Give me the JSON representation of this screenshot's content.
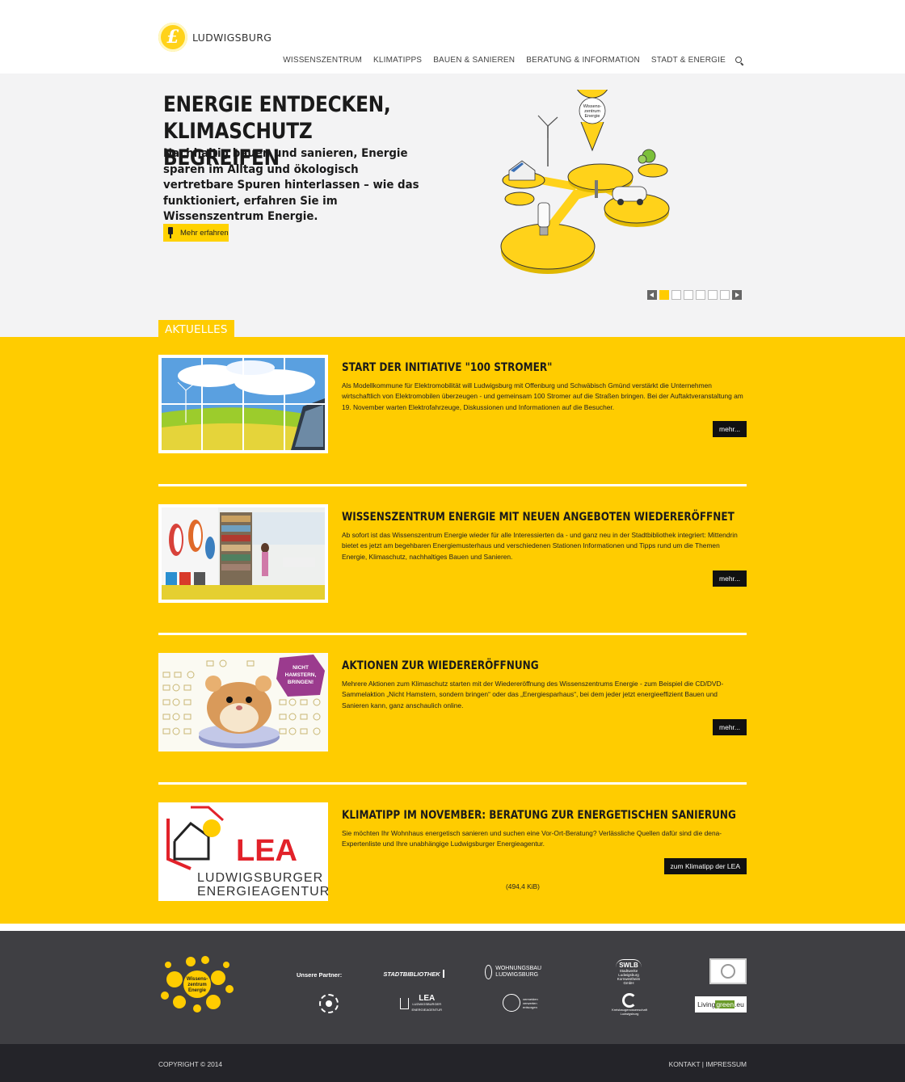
{
  "header": {
    "logo_text": "LUDWIGSBURG",
    "logo_glyph": "£",
    "nav": [
      "WISSENSZENTRUM",
      "KLIMATIPPS",
      "BAUEN & SANIEREN",
      "BERATUNG & INFORMATION",
      "STADT & ENERGIE"
    ]
  },
  "hero": {
    "title_line1": "ENERGIE ENTDECKEN,",
    "title_line2": "KLIMASCHUTZ BEGREIFEN",
    "text": "Nachhaltig bauen und sanieren, Energie sparen im Alltag und ökologisch vertretbare Spuren hinterlassen – wie das funktioniert, erfahren Sie im Wissenszentrum Energie.",
    "button_label": "Mehr erfahren",
    "illustration_pin_text": [
      "Wissens-",
      "zentrum",
      "Energie"
    ],
    "slides_total": 7,
    "slide_active": 1
  },
  "news": {
    "section_label": "AKTUELLES",
    "items": [
      {
        "title": "START DER INITIATIVE \"100 STROMER\"",
        "body": "Als Modellkommune für Elektromobilität will Ludwigsburg mit Offenburg und Schwäbisch Gmünd verstärkt die Unternehmen wirtschaftlich von Elektromobilen überzeugen - und gemeinsam 100 Stromer auf die Straßen bringen. Bei der Auftaktveranstaltung am 19. November warten Elektrofahrzeuge, Diskussionen und Informationen auf die Besucher.",
        "button": "mehr..."
      },
      {
        "title": "WISSENSZENTRUM ENERGIE MIT NEUEN ANGEBOTEN WIEDERERÖFFNET",
        "body": "Ab sofort ist das Wissenszentrum Energie wieder für alle Interessierten da - und ganz neu in der Stadtbibliothek integriert: Mittendrin bietet es jetzt am begehbaren Energiemusterhaus und verschiedenen Stationen Informationen und Tipps rund um die Themen Energie, Klimaschutz, nachhaltiges Bauen und Sanieren.",
        "button": "mehr..."
      },
      {
        "title": "AKTIONEN ZUR WIEDERERÖFFNUNG",
        "body": "Mehrere Aktionen zum Klimaschutz starten mit der Wiedereröffnung des Wissenszentrums Energie - zum Beispiel die CD/DVD-Sammelaktion „Nicht Hamstern, sondern bringen“ oder das „Energiesparhaus“, bei dem jeder jetzt energieeffizient Bauen und Sanieren kann, ganz anschaulich online.",
        "button": "mehr...",
        "badge_text": [
          "NICHT",
          "HAMSTERN,",
          "BRINGEN!"
        ]
      },
      {
        "title": "KLIMATIPP IM NOVEMBER: BERATUNG ZUR ENERGETISCHEN SANIERUNG",
        "body": "Sie möchten Ihr Wohnhaus energetisch sanieren und suchen eine Vor-Ort-Beratung? Verlässliche Quellen dafür sind die dena-Expertenliste und Ihre unabhängige Ludwigsburger Energieagentur.",
        "button": "zum Klimatipp der LEA",
        "file_size": "(494,4 KiB)",
        "logo_main": "LEA",
        "logo_line1": "LUDWIGSBURGER",
        "logo_line2": "ENERGIEAGENTUR"
      }
    ]
  },
  "footer": {
    "logo_text": [
      "Wissens-",
      "zentrum",
      "Energie"
    ],
    "partners_label": "Unsere Partner:",
    "partners": {
      "stadtbibliothek": "STADTBIBLIOTHEK",
      "wohnungsbau": [
        "WOHNUNGSBAU",
        "LUDWIGSBURG"
      ],
      "swlb": "SWLB",
      "swlb_sub": [
        "Stadtwerke Ludwigsburg",
        "Kornwestheim GmbH"
      ],
      "lea": "LEA",
      "lea_sub": [
        "LUDWIGSBURGER",
        "ENERGIEAGENTUR"
      ],
      "avl": [
        "vermeiden",
        "verwerten",
        "entsorgen"
      ],
      "kreis": [
        "Kreisbaugenossenschaft",
        "Ludwigsburg"
      ],
      "livinggreen": [
        "Living",
        "green",
        ".eu"
      ]
    },
    "copyright": "COPYRIGHT © 2014",
    "links": [
      "KONTAKT",
      "IMPRESSUM"
    ],
    "link_separator": "|"
  },
  "colors": {
    "brand_yellow": "#ffcc00",
    "hero_bg": "#f3f3f4",
    "footer_bg": "#3f3f43",
    "bottom_bg": "#242429"
  }
}
